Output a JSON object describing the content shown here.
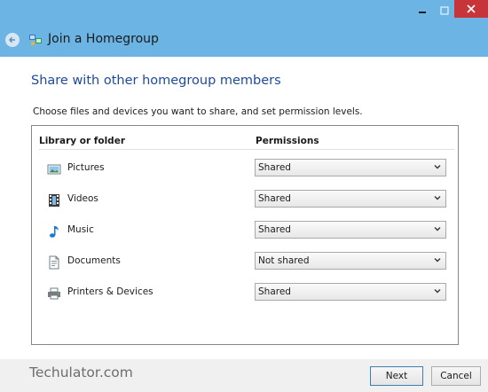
{
  "window": {
    "title": "Join a Homegroup",
    "minimize_glyph": "–",
    "maximize_glyph": "□",
    "close_glyph": "×",
    "accent": "#6cb4e4",
    "close_color": "#c7343a"
  },
  "main": {
    "heading": "Share with other homegroup members",
    "instruction": "Choose files and devices you want to share, and set permission levels."
  },
  "table": {
    "headers": {
      "library": "Library or folder",
      "permissions": "Permissions"
    },
    "rows": [
      {
        "label": "Pictures",
        "icon": "pictures-icon",
        "permission": "Shared"
      },
      {
        "label": "Videos",
        "icon": "videos-icon",
        "permission": "Shared"
      },
      {
        "label": "Music",
        "icon": "music-icon",
        "permission": "Shared"
      },
      {
        "label": "Documents",
        "icon": "documents-icon",
        "permission": "Not shared"
      },
      {
        "label": "Printers & Devices",
        "icon": "printers-icon",
        "permission": "Shared"
      }
    ]
  },
  "footer": {
    "watermark": "Techulator.com",
    "next_label": "Next",
    "cancel_label": "Cancel"
  }
}
